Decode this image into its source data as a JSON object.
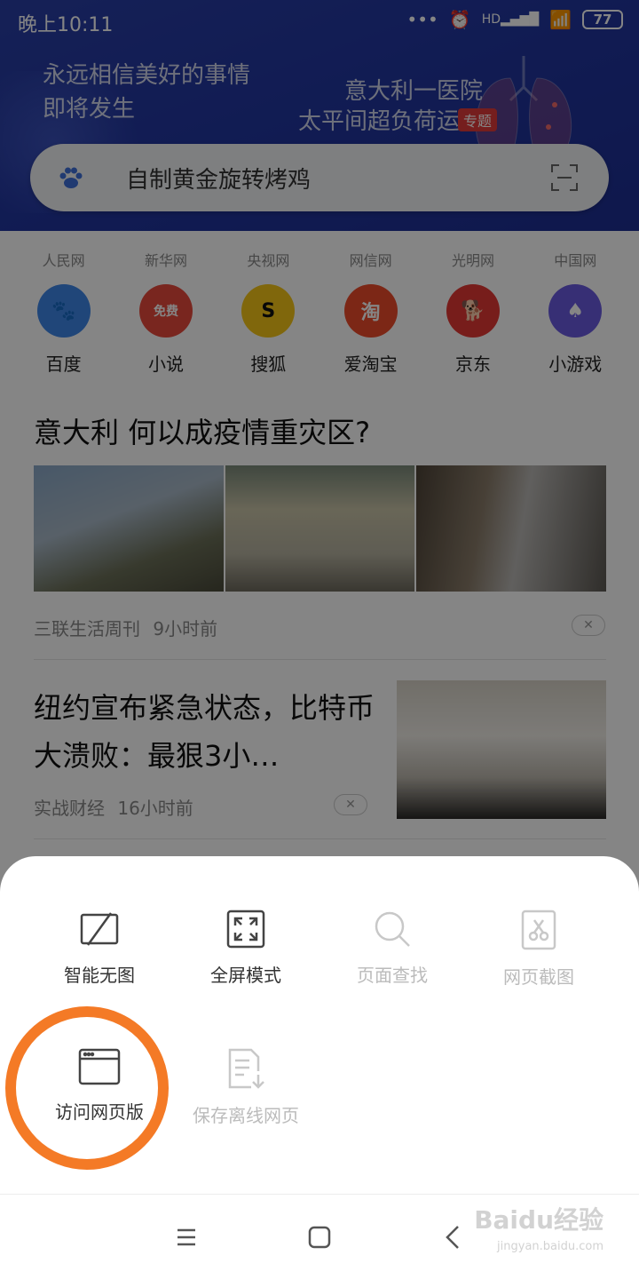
{
  "status_bar": {
    "time": "晚上10:11",
    "battery": "77",
    "network": "HD"
  },
  "header": {
    "slogan_line1": "永远相信美好的事情",
    "slogan_line2": "即将发生",
    "promo_line1": "意大利一医院",
    "promo_line2": "太平间超负荷运转",
    "promo_tag": "专题",
    "search_query": "自制黄金旋转烤鸡"
  },
  "sources": [
    "人民网",
    "新华网",
    "央视网",
    "网信网",
    "光明网",
    "中国网"
  ],
  "apps": [
    {
      "label": "百度",
      "color": "#3f86e8",
      "glyph": "🐾"
    },
    {
      "label": "小说",
      "color": "#e84a3c",
      "glyph": "免费"
    },
    {
      "label": "搜狐",
      "color": "#f5c518",
      "glyph": "S"
    },
    {
      "label": "爱淘宝",
      "color": "#ee4b2b",
      "glyph": "淘"
    },
    {
      "label": "京东",
      "color": "#e53935",
      "glyph": "🐕"
    },
    {
      "label": "小游戏",
      "color": "#6a5ae0",
      "glyph": "♠"
    }
  ],
  "feed": {
    "story1": {
      "title": "意大利 何以成疫情重灾区?",
      "source": "三联生活周刊",
      "time": "9小时前"
    },
    "story2": {
      "title": "纽约宣布紧急状态，比特币大溃败：最狠3小…",
      "source": "实战财经",
      "time": "16小时前"
    }
  },
  "sheet": {
    "tools": [
      {
        "label": "智能无图",
        "icon": "no-image-icon",
        "enabled": true
      },
      {
        "label": "全屏模式",
        "icon": "fullscreen-icon",
        "enabled": true
      },
      {
        "label": "页面查找",
        "icon": "search-icon",
        "enabled": false
      },
      {
        "label": "网页截图",
        "icon": "scissors-icon",
        "enabled": false
      },
      {
        "label": "访问网页版",
        "icon": "browser-window-icon",
        "enabled": true
      },
      {
        "label": "保存离线网页",
        "icon": "save-offline-icon",
        "enabled": false
      }
    ],
    "highlight_color": "#f47a26"
  },
  "watermark": {
    "main": "Baidu经验",
    "sub": "jingyan.baidu.com"
  }
}
